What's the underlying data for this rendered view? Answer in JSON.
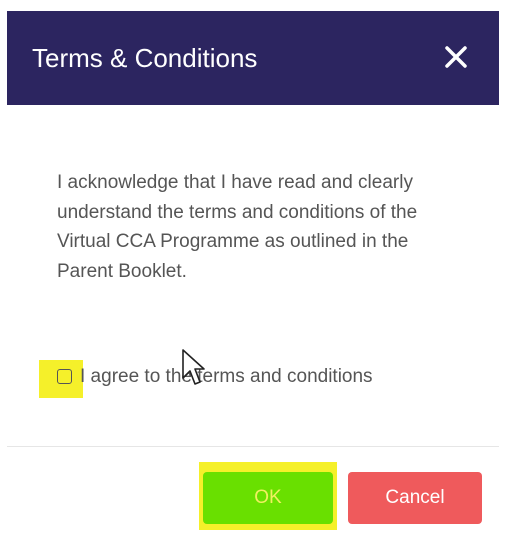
{
  "dialog": {
    "title": "Terms & Conditions",
    "close_icon": "close-icon",
    "body_text": "I acknowledge that I have read and clearly understand the terms and conditions of the Virtual CCA Programme as outlined in the Parent Booklet.",
    "checkbox": {
      "label": "I agree to the terms and conditions",
      "checked": false
    },
    "buttons": {
      "ok_label": "OK",
      "cancel_label": "Cancel"
    }
  },
  "colors": {
    "header_bg": "#2c2560",
    "ok_bg": "#69e000",
    "cancel_bg": "#ef5a5c",
    "highlight": "#f5f02a",
    "body_text": "#555555"
  },
  "overlay": {
    "cursor_icon": "mouse-pointer-icon"
  }
}
